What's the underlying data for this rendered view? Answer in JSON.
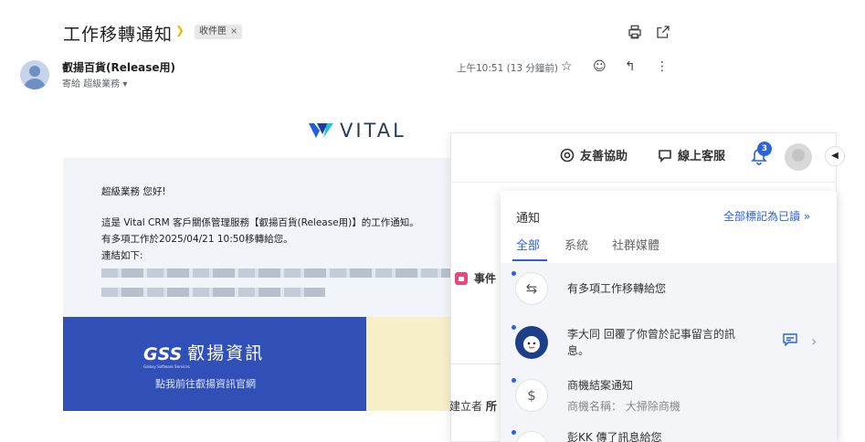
{
  "email": {
    "subject": "工作移轉通知",
    "label": "收件匣",
    "label_close": "×",
    "sender": "叡揚百貨(Release用)",
    "to_line": "寄給 超級業務 ▾",
    "time": "上午10:51 (13 分鐘前)"
  },
  "body": {
    "logo_text": "VITAL",
    "greeting": "超級業務 您好!",
    "line1": "這是 Vital CRM 客戶關係管理服務【叡揚百貨(Release用)】的工作通知。",
    "line2": "有多項工作於2025/04/21 10:50移轉給您。",
    "line3": "連結如下:",
    "banner_logo": "GSS",
    "banner_logo_sub": "Galaxy Software Services",
    "banner_company": "叡揚資訊",
    "banner_link": "點我前往叡揚資訊官網"
  },
  "crm": {
    "help_label": "友善協助",
    "support_label": "線上客服",
    "notif_count": "3",
    "collapse_glyph": "◀",
    "event_label": "事件",
    "creator_label": "建立者",
    "creator_value": "所"
  },
  "notifications": {
    "title": "通知",
    "mark_all": "全部標記為已讀 »",
    "tabs": [
      "全部",
      "系統",
      "社群媒體"
    ],
    "items": [
      {
        "text": "有多項工作移轉給您",
        "sub": ""
      },
      {
        "text": "李大同 回覆了你曾於記事留言的訊",
        "text2": "息。",
        "sub": ""
      },
      {
        "text": "商機結案通知",
        "sub": "商機名稱： 大掃除商機"
      },
      {
        "text": "彭KK 傳了訊息給您",
        "sub": ""
      }
    ]
  },
  "colors": {
    "accent": "#2b62e0",
    "banner_blue": "#3150b7",
    "banner_yellow": "#f7efc8",
    "event_pink": "#e5487b"
  }
}
